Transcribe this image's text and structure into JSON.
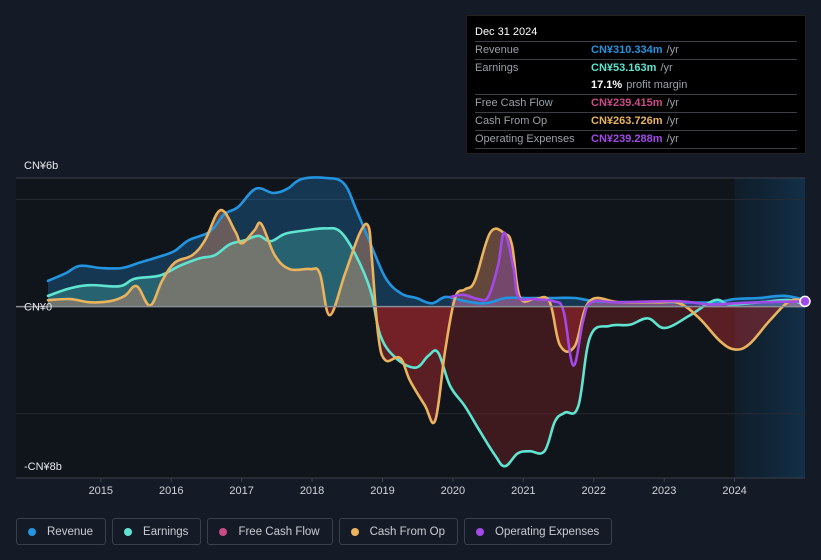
{
  "tooltip": {
    "date": "Dec 31 2024",
    "rows": [
      {
        "label": "Revenue",
        "value": "CN¥310.334m",
        "unit": "/yr",
        "color": "#2394df"
      },
      {
        "label": "Earnings",
        "value": "CN¥53.163m",
        "unit": "/yr",
        "color": "#5ee4d0"
      },
      {
        "label": "",
        "value": "17.1%",
        "unit": "profit margin",
        "color": "#ffffff"
      },
      {
        "label": "Free Cash Flow",
        "value": "CN¥239.415m",
        "unit": "/yr",
        "color": "#c94c87"
      },
      {
        "label": "Cash From Op",
        "value": "CN¥263.726m",
        "unit": "/yr",
        "color": "#eab35e"
      },
      {
        "label": "Operating Expenses",
        "value": "CN¥239.288m",
        "unit": "/yr",
        "color": "#a24ae8"
      }
    ]
  },
  "legend": [
    {
      "label": "Revenue",
      "color": "#2394df"
    },
    {
      "label": "Earnings",
      "color": "#5ee4d0"
    },
    {
      "label": "Free Cash Flow",
      "color": "#c94c87"
    },
    {
      "label": "Cash From Op",
      "color": "#eab35e"
    },
    {
      "label": "Operating Expenses",
      "color": "#a24ae8"
    }
  ],
  "chart_data": {
    "type": "area",
    "title": "",
    "xlabel": "",
    "ylabel": "",
    "y_unit": "CN¥ billions",
    "ylim": [
      -8,
      6
    ],
    "xlim": [
      2014.25,
      2025.0
    ],
    "y_tick_labels": [
      {
        "value": 6,
        "label": "CN¥6b"
      },
      {
        "value": 0,
        "label": "CN¥0"
      },
      {
        "value": -8,
        "label": "-CN¥8b"
      }
    ],
    "x_ticks": [
      2015,
      2016,
      2017,
      2018,
      2019,
      2020,
      2021,
      2022,
      2023,
      2024
    ],
    "highlight_from": 2024.0,
    "grid": true,
    "legend_position": "bottom-left",
    "series": [
      {
        "name": "Revenue",
        "color": "#2394df",
        "points": [
          [
            2014.25,
            1.2
          ],
          [
            2014.5,
            1.55
          ],
          [
            2014.7,
            1.9
          ],
          [
            2015.0,
            1.8
          ],
          [
            2015.3,
            1.8
          ],
          [
            2015.55,
            2.05
          ],
          [
            2015.85,
            2.35
          ],
          [
            2016.05,
            2.6
          ],
          [
            2016.25,
            3.1
          ],
          [
            2016.55,
            3.5
          ],
          [
            2016.75,
            4.3
          ],
          [
            2016.95,
            4.65
          ],
          [
            2017.2,
            5.5
          ],
          [
            2017.45,
            5.3
          ],
          [
            2017.65,
            5.5
          ],
          [
            2017.85,
            5.95
          ],
          [
            2018.2,
            6.0
          ],
          [
            2018.45,
            5.75
          ],
          [
            2018.63,
            4.5
          ],
          [
            2018.84,
            2.85
          ],
          [
            2019.05,
            1.3
          ],
          [
            2019.27,
            0.6
          ],
          [
            2019.48,
            0.4
          ],
          [
            2019.7,
            0.15
          ],
          [
            2019.9,
            0.45
          ],
          [
            2020.18,
            0.25
          ],
          [
            2020.46,
            0.15
          ],
          [
            2020.75,
            0.4
          ],
          [
            2021.03,
            0.4
          ],
          [
            2021.45,
            0.4
          ],
          [
            2021.74,
            0.4
          ],
          [
            2022.02,
            0.25
          ],
          [
            2022.59,
            0.2
          ],
          [
            2023.15,
            0.2
          ],
          [
            2023.72,
            0.2
          ],
          [
            2024.0,
            0.35
          ],
          [
            2024.35,
            0.4
          ],
          [
            2024.7,
            0.5
          ],
          [
            2025.0,
            0.31
          ]
        ]
      },
      {
        "name": "Earnings",
        "color": "#5ee4d0",
        "points": [
          [
            2014.25,
            0.5
          ],
          [
            2014.56,
            0.85
          ],
          [
            2014.85,
            1.0
          ],
          [
            2015.27,
            0.95
          ],
          [
            2015.48,
            1.3
          ],
          [
            2015.84,
            1.45
          ],
          [
            2016.12,
            1.9
          ],
          [
            2016.4,
            2.25
          ],
          [
            2016.62,
            2.4
          ],
          [
            2016.83,
            2.9
          ],
          [
            2017.05,
            3.1
          ],
          [
            2017.24,
            3.3
          ],
          [
            2017.41,
            3.05
          ],
          [
            2017.62,
            3.4
          ],
          [
            2017.9,
            3.55
          ],
          [
            2018.19,
            3.65
          ],
          [
            2018.4,
            3.5
          ],
          [
            2018.62,
            2.4
          ],
          [
            2018.83,
            0.75
          ],
          [
            2018.97,
            -1.35
          ],
          [
            2019.19,
            -2.4
          ],
          [
            2019.47,
            -2.85
          ],
          [
            2019.65,
            -2.3
          ],
          [
            2019.79,
            -2.15
          ],
          [
            2019.96,
            -3.7
          ],
          [
            2020.17,
            -4.65
          ],
          [
            2020.38,
            -5.8
          ],
          [
            2020.6,
            -6.95
          ],
          [
            2020.74,
            -7.45
          ],
          [
            2020.92,
            -6.85
          ],
          [
            2021.09,
            -6.75
          ],
          [
            2021.3,
            -6.75
          ],
          [
            2021.45,
            -5.35
          ],
          [
            2021.59,
            -4.95
          ],
          [
            2021.78,
            -4.65
          ],
          [
            2021.95,
            -1.4
          ],
          [
            2022.23,
            -0.9
          ],
          [
            2022.51,
            -0.85
          ],
          [
            2022.77,
            -0.55
          ],
          [
            2023.01,
            -1.0
          ],
          [
            2023.37,
            -0.4
          ],
          [
            2023.72,
            0.3
          ],
          [
            2023.93,
            0.1
          ],
          [
            2024.35,
            0.2
          ],
          [
            2024.78,
            0.3
          ],
          [
            2025.0,
            0.05
          ]
        ]
      },
      {
        "name": "Free Cash Flow",
        "color": "#c94c87",
        "points": [
          [
            2014.25,
            0.3
          ],
          [
            2014.56,
            0.35
          ],
          [
            2014.85,
            0.2
          ],
          [
            2015.13,
            0.25
          ],
          [
            2015.34,
            0.5
          ],
          [
            2015.51,
            0.95
          ],
          [
            2015.7,
            0.05
          ],
          [
            2015.87,
            1.2
          ],
          [
            2016.05,
            2.05
          ],
          [
            2016.3,
            2.4
          ],
          [
            2016.48,
            3.1
          ],
          [
            2016.7,
            4.5
          ],
          [
            2016.91,
            3.5
          ],
          [
            2017.0,
            2.95
          ],
          [
            2017.18,
            3.55
          ],
          [
            2017.28,
            3.85
          ],
          [
            2017.47,
            2.4
          ],
          [
            2017.68,
            1.75
          ],
          [
            2017.97,
            1.75
          ],
          [
            2018.11,
            1.55
          ],
          [
            2018.25,
            -0.4
          ],
          [
            2018.47,
            1.55
          ],
          [
            2018.68,
            3.45
          ],
          [
            2018.8,
            3.75
          ],
          [
            2018.85,
            2.2
          ],
          [
            2018.94,
            -1.35
          ],
          [
            2019.04,
            -2.5
          ],
          [
            2019.25,
            -2.4
          ],
          [
            2019.39,
            -3.45
          ],
          [
            2019.6,
            -4.6
          ],
          [
            2019.75,
            -5.3
          ],
          [
            2019.89,
            -2.05
          ],
          [
            2020.03,
            0.4
          ],
          [
            2020.17,
            0.8
          ],
          [
            2020.31,
            1.2
          ],
          [
            2020.53,
            3.45
          ],
          [
            2020.74,
            3.4
          ],
          [
            2020.84,
            2.85
          ],
          [
            2020.95,
            0.45
          ],
          [
            2021.16,
            0.35
          ],
          [
            2021.37,
            0.25
          ],
          [
            2021.52,
            -1.8
          ],
          [
            2021.73,
            -1.85
          ],
          [
            2021.94,
            0.25
          ],
          [
            2022.37,
            0.2
          ],
          [
            2022.93,
            0.2
          ],
          [
            2023.22,
            0.15
          ],
          [
            2023.5,
            -0.55
          ],
          [
            2023.79,
            -1.6
          ],
          [
            2024.0,
            -2.0
          ],
          [
            2024.21,
            -1.75
          ],
          [
            2024.5,
            -0.65
          ],
          [
            2024.78,
            0.25
          ],
          [
            2025.0,
            0.24
          ]
        ]
      },
      {
        "name": "Cash From Op",
        "color": "#eab35e",
        "points": [
          [
            2014.25,
            0.3
          ],
          [
            2014.56,
            0.35
          ],
          [
            2014.85,
            0.2
          ],
          [
            2015.13,
            0.25
          ],
          [
            2015.34,
            0.5
          ],
          [
            2015.51,
            0.95
          ],
          [
            2015.7,
            0.05
          ],
          [
            2015.87,
            1.2
          ],
          [
            2016.05,
            2.05
          ],
          [
            2016.3,
            2.4
          ],
          [
            2016.48,
            3.1
          ],
          [
            2016.7,
            4.5
          ],
          [
            2016.91,
            3.5
          ],
          [
            2017.0,
            2.95
          ],
          [
            2017.18,
            3.55
          ],
          [
            2017.28,
            3.85
          ],
          [
            2017.47,
            2.4
          ],
          [
            2017.68,
            1.75
          ],
          [
            2017.97,
            1.75
          ],
          [
            2018.11,
            1.55
          ],
          [
            2018.25,
            -0.4
          ],
          [
            2018.47,
            1.55
          ],
          [
            2018.68,
            3.45
          ],
          [
            2018.8,
            3.75
          ],
          [
            2018.85,
            2.2
          ],
          [
            2018.94,
            -1.35
          ],
          [
            2019.04,
            -2.5
          ],
          [
            2019.25,
            -2.4
          ],
          [
            2019.39,
            -3.45
          ],
          [
            2019.6,
            -4.6
          ],
          [
            2019.75,
            -5.3
          ],
          [
            2019.89,
            -2.05
          ],
          [
            2020.03,
            0.4
          ],
          [
            2020.17,
            0.8
          ],
          [
            2020.31,
            1.2
          ],
          [
            2020.53,
            3.45
          ],
          [
            2020.74,
            3.4
          ],
          [
            2020.84,
            2.85
          ],
          [
            2020.95,
            0.45
          ],
          [
            2021.16,
            0.35
          ],
          [
            2021.37,
            0.25
          ],
          [
            2021.52,
            -1.8
          ],
          [
            2021.73,
            -1.85
          ],
          [
            2021.94,
            0.25
          ],
          [
            2022.37,
            0.2
          ],
          [
            2022.93,
            0.2
          ],
          [
            2023.22,
            0.15
          ],
          [
            2023.5,
            -0.55
          ],
          [
            2023.79,
            -1.6
          ],
          [
            2024.0,
            -2.0
          ],
          [
            2024.21,
            -1.75
          ],
          [
            2024.5,
            -0.65
          ],
          [
            2024.78,
            0.25
          ],
          [
            2025.0,
            0.26
          ]
        ]
      },
      {
        "name": "Operating Expenses",
        "color": "#a24ae8",
        "points": [
          [
            2019.97,
            0.45
          ],
          [
            2020.15,
            0.55
          ],
          [
            2020.36,
            0.35
          ],
          [
            2020.5,
            0.45
          ],
          [
            2020.64,
            1.9
          ],
          [
            2020.73,
            3.45
          ],
          [
            2020.86,
            1.8
          ],
          [
            2020.93,
            0.45
          ],
          [
            2021.14,
            0.35
          ],
          [
            2021.43,
            0.25
          ],
          [
            2021.57,
            -0.2
          ],
          [
            2021.71,
            -2.75
          ],
          [
            2021.85,
            -0.65
          ],
          [
            2021.97,
            0.2
          ],
          [
            2022.35,
            0.2
          ],
          [
            2023.2,
            0.25
          ],
          [
            2023.63,
            0.1
          ],
          [
            2024.0,
            0.15
          ],
          [
            2024.35,
            0.2
          ],
          [
            2025.0,
            0.24
          ]
        ]
      }
    ]
  }
}
